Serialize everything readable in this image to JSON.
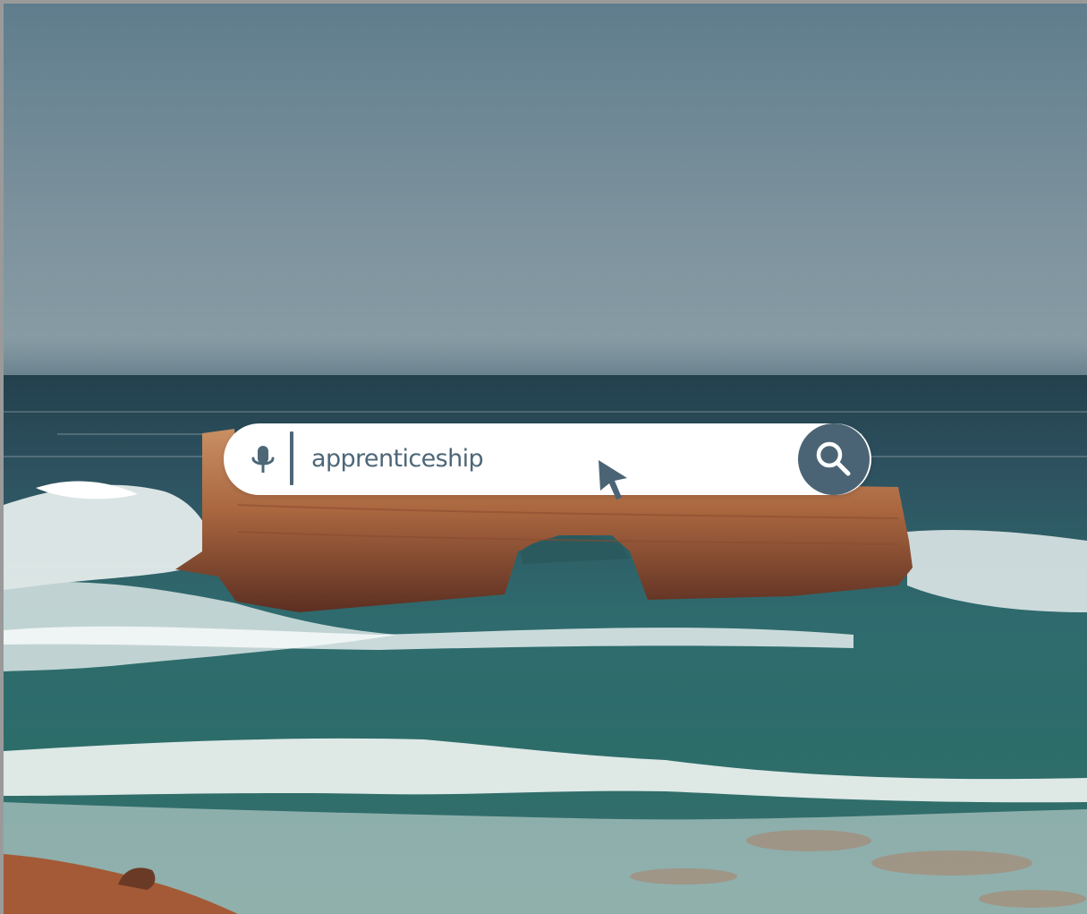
{
  "search": {
    "value": "apprenticeship",
    "mic_icon": "microphone-icon",
    "submit_icon": "search-icon"
  },
  "pointer_icon": "arrow-cursor-icon",
  "background_image": "coastal-rock-arch-seascape",
  "colors": {
    "accent": "#4b6475",
    "text": "#4d6777",
    "bar": "#ffffff"
  }
}
